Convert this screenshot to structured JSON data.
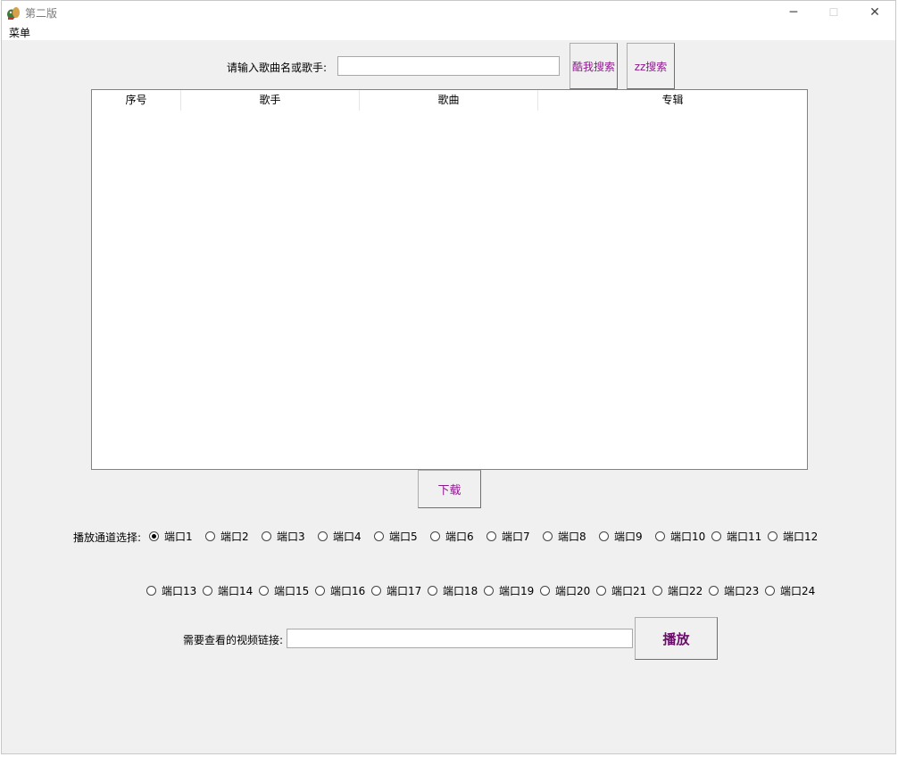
{
  "window": {
    "title": "第二版",
    "minimize": "─",
    "maximize": "☐",
    "close": "✕"
  },
  "menu": {
    "label": "菜单"
  },
  "search": {
    "label": "请输入歌曲名或歌手:",
    "value": "",
    "kuwo_button": "酷我搜索",
    "zz_button": "zz搜索"
  },
  "table": {
    "columns": [
      "序号",
      "歌手",
      "歌曲",
      "专辑"
    ],
    "rows": []
  },
  "download_button": "下载",
  "channel": {
    "label": "播放通道选择:",
    "selected": "端口1",
    "options": [
      "端口1",
      "端口2",
      "端口3",
      "端口4",
      "端口5",
      "端口6",
      "端口7",
      "端口8",
      "端口9",
      "端口10",
      "端口11",
      "端口12",
      "端口13",
      "端口14",
      "端口15",
      "端口16",
      "端口17",
      "端口18",
      "端口19",
      "端口20",
      "端口21",
      "端口22",
      "端口23",
      "端口24"
    ]
  },
  "video": {
    "label": "需要查看的视频链接:",
    "value": "",
    "play_button": "播放"
  },
  "colors": {
    "button_text": "#8b1a8b",
    "play_text": "#6a0a6a"
  }
}
